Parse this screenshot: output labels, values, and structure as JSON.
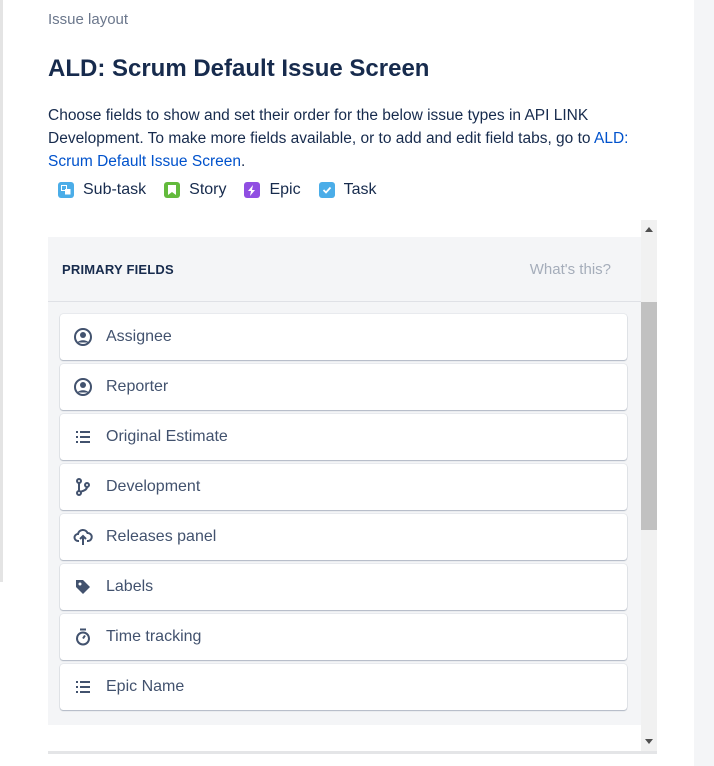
{
  "breadcrumb": "Issue layout",
  "title": "ALD: Scrum Default Issue Screen",
  "description": {
    "text": "Choose fields to show and set their order for the below issue types in API LINK Development. To make more fields available, or to add and edit field tabs, go to ",
    "link": "ALD: Scrum Default Issue Screen",
    "end": "."
  },
  "issue_types": [
    {
      "label": "Sub-task",
      "color": "#4bade8",
      "icon": "subtask-icon"
    },
    {
      "label": "Story",
      "color": "#63ba3c",
      "icon": "story-icon"
    },
    {
      "label": "Epic",
      "color": "#904ee2",
      "icon": "epic-icon"
    },
    {
      "label": "Task",
      "color": "#4bade8",
      "icon": "task-icon"
    }
  ],
  "panel": {
    "title": "PRIMARY FIELDS",
    "help": "What's this?",
    "fields": [
      {
        "label": "Assignee",
        "icon": "user-icon"
      },
      {
        "label": "Reporter",
        "icon": "user-icon"
      },
      {
        "label": "Original Estimate",
        "icon": "list-icon"
      },
      {
        "label": "Development",
        "icon": "branch-icon"
      },
      {
        "label": "Releases panel",
        "icon": "cloud-upload-icon"
      },
      {
        "label": "Labels",
        "icon": "tag-icon"
      },
      {
        "label": "Time tracking",
        "icon": "stopwatch-icon"
      },
      {
        "label": "Epic Name",
        "icon": "list-icon"
      }
    ]
  }
}
